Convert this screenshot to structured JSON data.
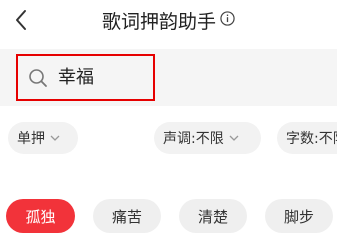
{
  "header": {
    "title": "歌词押韵助手",
    "back_icon": "chevron-left-icon",
    "info_icon": "info-circle-icon"
  },
  "search": {
    "value": "幸福",
    "icon": "search-icon",
    "highlight_color": "#e60000"
  },
  "filters": [
    {
      "label": "单押"
    },
    {
      "label": "声调:不限"
    },
    {
      "label": "字数:不限"
    }
  ],
  "tags": [
    {
      "label": "孤独",
      "selected": true
    },
    {
      "label": "痛苦",
      "selected": false
    },
    {
      "label": "清楚",
      "selected": false
    },
    {
      "label": "脚步",
      "selected": false
    }
  ],
  "colors": {
    "accent": "#f2333a",
    "search_bg": "#f5f5f5",
    "chip_bg": "#f2f2f2"
  }
}
